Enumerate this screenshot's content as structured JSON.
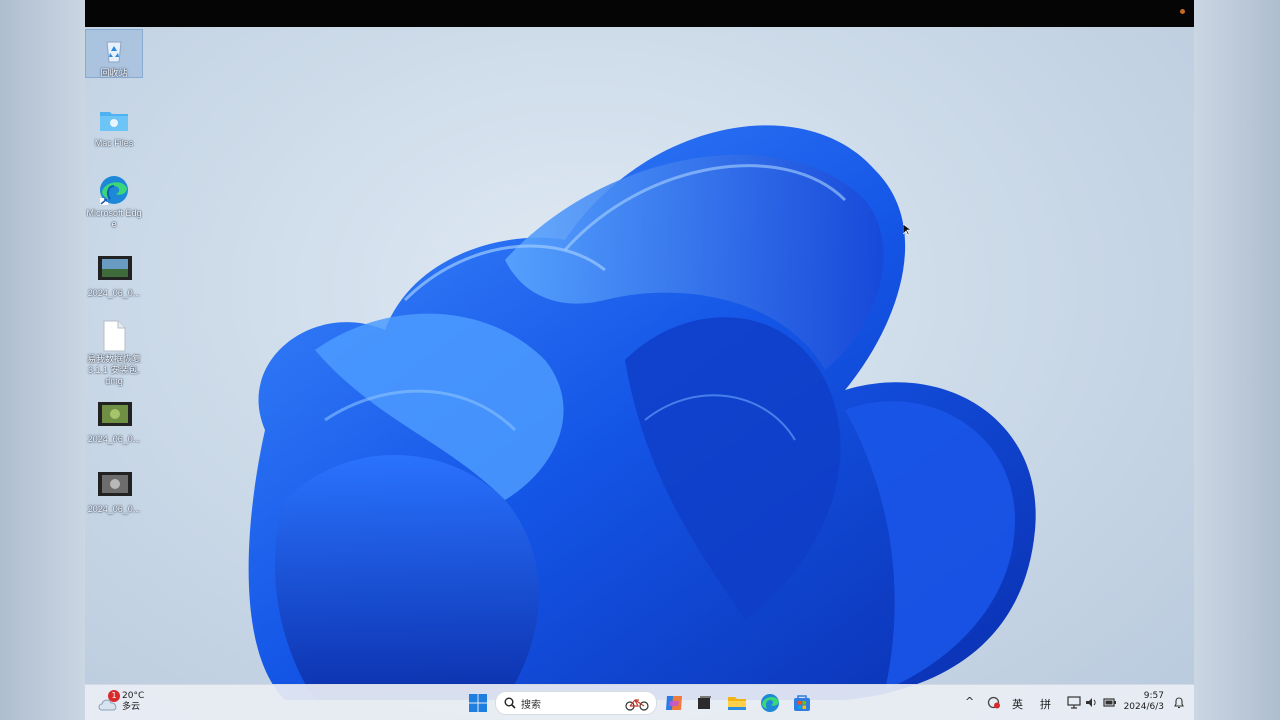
{
  "desktop": {
    "icons": [
      {
        "label": "回收站",
        "icon": "recycle-bin-icon"
      },
      {
        "label": "Mac Files",
        "icon": "folder-icon"
      },
      {
        "label": "Microsoft Edge",
        "icon": "edge-icon"
      },
      {
        "label": "2024_06_0...",
        "icon": "video-thumbnail-icon"
      },
      {
        "label": "易我数据恢复 3.1.1 安装包.dmg",
        "icon": "file-icon"
      },
      {
        "label": "2024_06_0...",
        "icon": "video-thumbnail-icon"
      },
      {
        "label": "2024_06_0...",
        "icon": "video-thumbnail-icon"
      }
    ]
  },
  "taskbar": {
    "weather": {
      "temp": "20°C",
      "condition": "多云",
      "badge": "1"
    },
    "search_label": "搜索",
    "apps": [
      "windows-start-icon",
      "copilot-icon",
      "task-view-icon",
      "file-explorer-icon",
      "edge-icon",
      "store-icon"
    ],
    "tray": {
      "chevron": "^",
      "ime_lang": "英",
      "ime_mode": "拼"
    },
    "clock": {
      "time": "9:57",
      "date": "2024/6/3"
    }
  },
  "colors": {
    "accent": "#1a5fe0",
    "taskbar_bg": "#eaeef4",
    "topbar": "#050505"
  }
}
